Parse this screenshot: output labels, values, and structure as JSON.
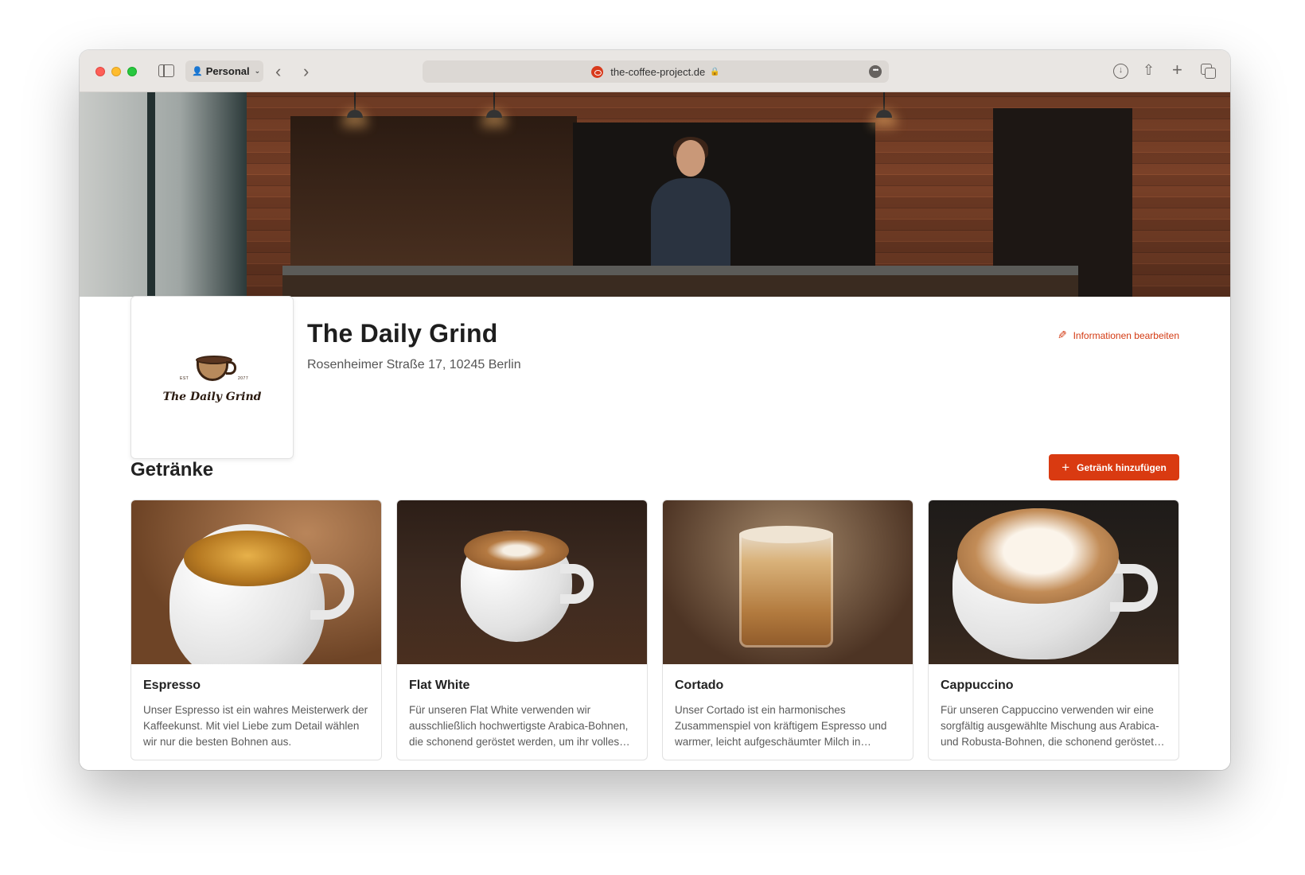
{
  "browser": {
    "profile_label": "Personal",
    "url": "the-coffee-project.de"
  },
  "logo": {
    "est": "EST",
    "year": "2077",
    "name": "The Daily Grind"
  },
  "cafe": {
    "name": "The Daily Grind",
    "address": "Rosenheimer Straße 17, 10245 Berlin",
    "edit_label": "Informationen bearbeiten"
  },
  "drinks": {
    "section_title": "Getränke",
    "add_label": "Getränk hinzufügen",
    "items": [
      {
        "title": "Espresso",
        "description": "Unser Espresso ist ein wahres Meisterwerk der Kaffeekunst. Mit viel Liebe zum Detail wählen wir nur die besten Bohnen aus."
      },
      {
        "title": "Flat White",
        "description": "Für unseren Flat White verwenden wir ausschließlich hochwertigste Arabica-Bohnen, die schonend geröstet werden, um ihr volles Aroma zu entfalten."
      },
      {
        "title": "Cortado",
        "description": "Unser Cortado ist ein harmonisches Zusammenspiel von kräftigem Espresso und warmer, leicht aufgeschäumter Milch in perfekter Balance."
      },
      {
        "title": "Cappuccino",
        "description": "Für unseren Cappuccino verwenden wir eine sorgfältig ausgewählte Mischung aus Arabica- und Robusta-Bohnen, die schonend geröstet werden."
      }
    ]
  },
  "colors": {
    "accent": "#d93a11",
    "toolbar": "#e9e6e3"
  }
}
